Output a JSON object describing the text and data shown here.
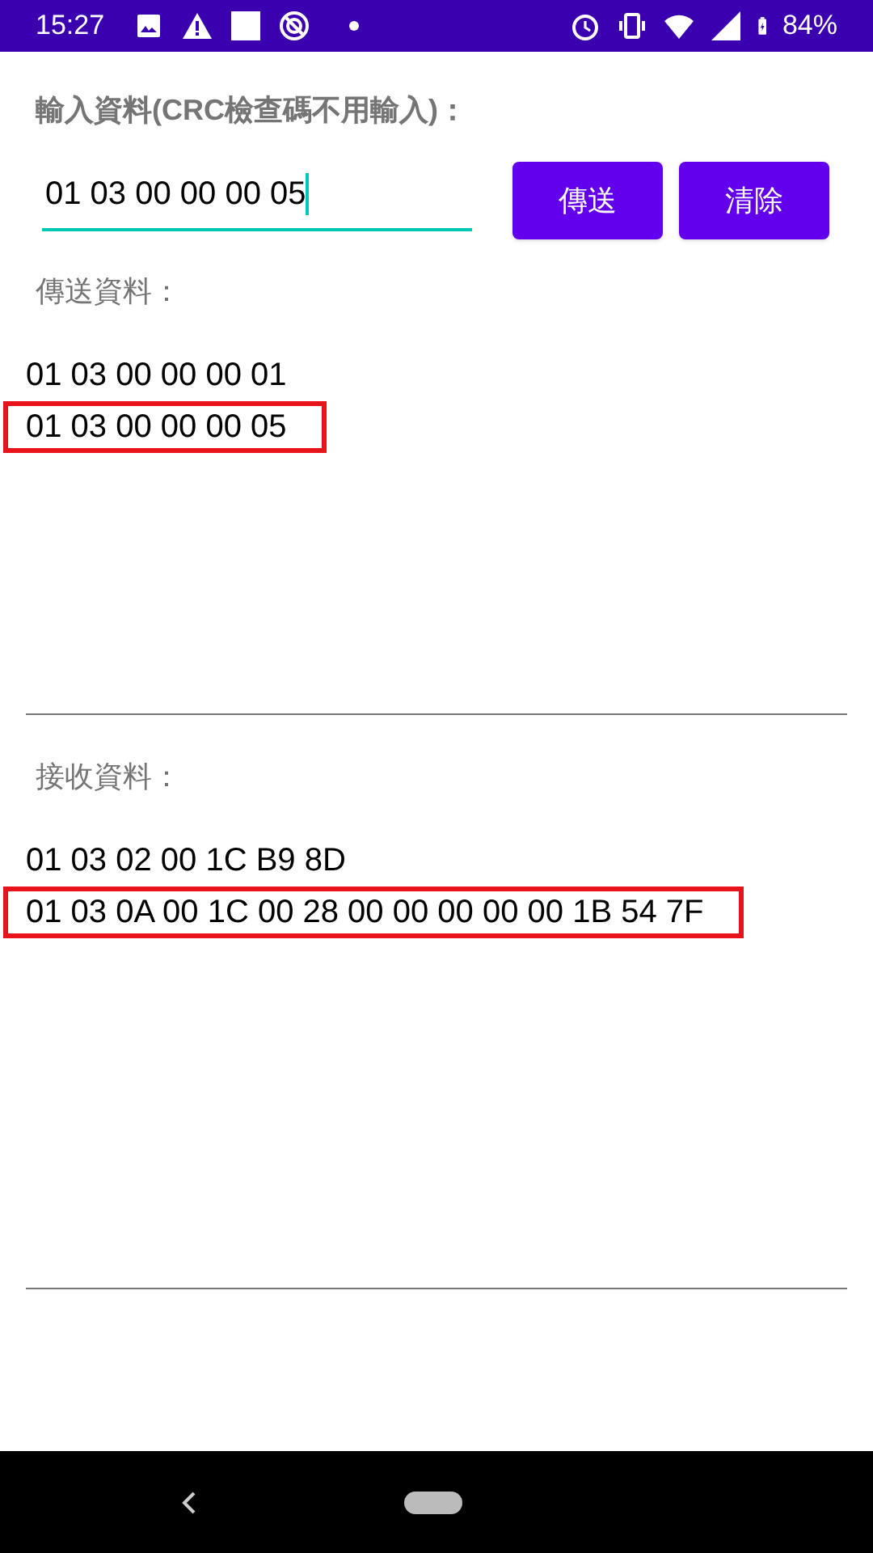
{
  "status_bar": {
    "time": "15:27",
    "battery": "84%"
  },
  "input_label": "輸入資料(CRC檢查碼不用輸入)：",
  "input": {
    "value": "01 03 00 00 00 05",
    "focused": true
  },
  "buttons": [
    {
      "label": "傳送"
    },
    {
      "label": "清除"
    }
  ],
  "sent": {
    "label": "傳送資料：",
    "lines": [
      {
        "text": "01 03 00 00 00 01",
        "highlighted": false
      },
      {
        "text": "01 03 00 00 00 05",
        "highlighted": true
      }
    ]
  },
  "received": {
    "label": "接收資料：",
    "lines": [
      {
        "text": "01 03 02 00 1C B9 8D",
        "highlighted": false
      },
      {
        "text": "01 03 0A 00 1C 00 28 00 00 00 00 00 1B 54 7F",
        "highlighted": true
      }
    ]
  }
}
